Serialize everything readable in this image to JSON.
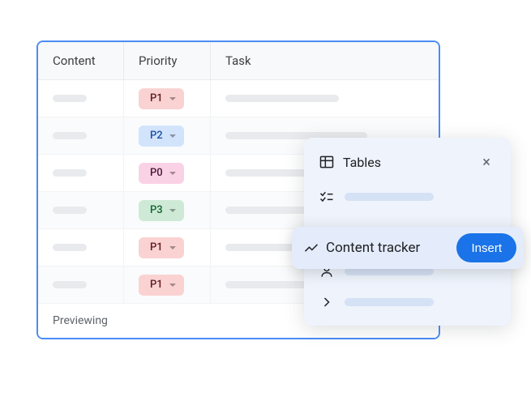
{
  "table": {
    "headers": {
      "content": "Content",
      "priority": "Priority",
      "task": "Task"
    },
    "rows": [
      {
        "priority": "P1",
        "chip_class": "chip-p1",
        "task_class": "skeleton-task-a"
      },
      {
        "priority": "P2",
        "chip_class": "chip-p2",
        "task_class": "skeleton-task-b"
      },
      {
        "priority": "P0",
        "chip_class": "chip-p0",
        "task_class": "skeleton-task-a"
      },
      {
        "priority": "P3",
        "chip_class": "chip-p3",
        "task_class": "skeleton-task-b"
      },
      {
        "priority": "P1",
        "chip_class": "chip-p1",
        "task_class": "skeleton-task-a"
      },
      {
        "priority": "P1",
        "chip_class": "chip-p1",
        "task_class": "skeleton-task-b"
      }
    ],
    "footer": "Previewing"
  },
  "panel": {
    "title": "Tables",
    "close": "×"
  },
  "hover": {
    "label": "Content tracker",
    "button": "Insert"
  }
}
